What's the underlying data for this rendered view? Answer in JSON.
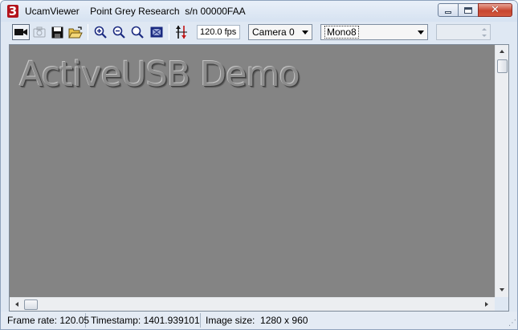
{
  "window": {
    "app_name": "UcamViewer",
    "subtitle": "Point Grey Research  s/n 00000FAA",
    "app_icon_glyph": "3",
    "min_glyph": "",
    "close_glyph": "✕"
  },
  "toolbar": {
    "icons": [
      "video-camera-icon",
      "snapshot-camera-icon",
      "save-icon",
      "open-folder-icon",
      "zoom-in-icon",
      "zoom-out-icon",
      "zoom-fit-icon",
      "fullscreen-icon",
      "property-arrows-icon"
    ],
    "fps": "120.0 fps",
    "camera_select": "Camera 0",
    "format_select": "Mono8",
    "spin_value": ""
  },
  "viewer": {
    "overlay_text": "ActiveUSB Demo",
    "background_color": "#848484"
  },
  "status": {
    "frame_rate": "Frame rate: 120.05",
    "timestamp": "Timestamp: 1401.939101",
    "image_size": "Image size:  1280 x 960"
  }
}
